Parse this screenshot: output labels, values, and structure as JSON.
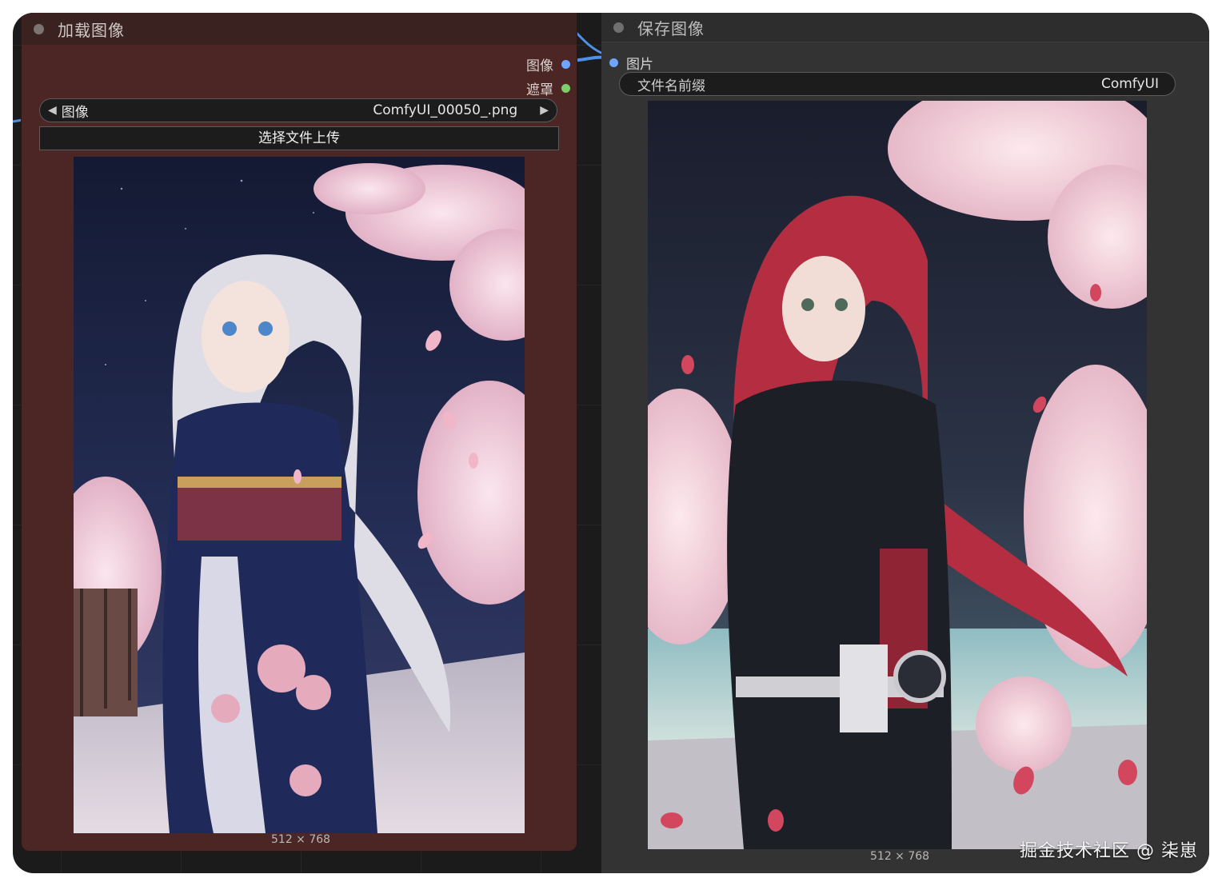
{
  "colors": {
    "load_node_bg": "#4b2624",
    "save_node_bg": "#333333",
    "image_slot": "#6fa4ff",
    "mask_slot": "#7ccf6a",
    "wire": "#4f8fe8"
  },
  "load_node": {
    "title": "加载图像",
    "outputs": [
      {
        "label": "图像",
        "slot_color": "#6fa4ff"
      },
      {
        "label": "遮罩",
        "slot_color": "#7ccf6a"
      }
    ],
    "image_widget": {
      "label": "图像",
      "value": "ComfyUI_00050_.png",
      "left_icon": "arrow-left-icon",
      "right_icon": "arrow-right-icon"
    },
    "upload_button": "选择文件上传",
    "preview_size": "512 × 768"
  },
  "save_node": {
    "title": "保存图像",
    "input": {
      "label": "图片",
      "slot_color": "#6fa4ff"
    },
    "prefix_widget": {
      "label": "文件名前缀",
      "value": "ComfyUI"
    },
    "preview_size": "512 × 768"
  },
  "watermark": "掘金技术社区 @ 柒崽"
}
